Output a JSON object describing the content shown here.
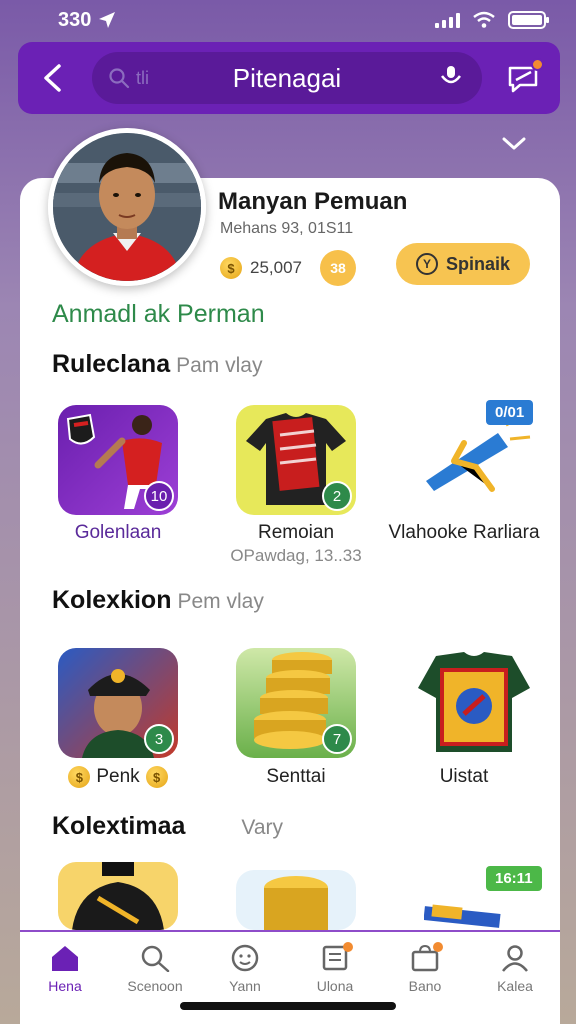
{
  "status_bar": {
    "time": "330"
  },
  "header": {
    "title": "Pitenagai",
    "search_placeholder": "tli",
    "accent_color": "#6b21b5"
  },
  "profile": {
    "name": "Manyan Pemuan",
    "meta": "Mehans 93, 01S11",
    "coins": "25,007",
    "coin_badge": "38",
    "action_label": "Spinaik",
    "subtitle": "Anmadl ak Perman"
  },
  "sections": [
    {
      "title": "Ruleclana",
      "muted": "Pam vlay",
      "items": [
        {
          "label": "Golenlaan",
          "sub": ""
        },
        {
          "label": "Remoian",
          "sub": "OPawdag, 13..33"
        },
        {
          "label": "Vlahooke Rarliara",
          "sub": "",
          "tag": "0/01"
        }
      ]
    },
    {
      "title": "Kolexkion",
      "muted": "Pem vlay",
      "items": [
        {
          "label": "Penk",
          "sub": ""
        },
        {
          "label": "Senttai",
          "sub": ""
        },
        {
          "label": "Uistat",
          "sub": ""
        }
      ]
    },
    {
      "title": "Kolextimaa",
      "muted": "Vary",
      "items": [
        {
          "tag": "16:11"
        }
      ]
    }
  ],
  "tabs": [
    {
      "label": "Hena",
      "icon": "home-icon"
    },
    {
      "label": "Scenoon",
      "icon": "search-icon"
    },
    {
      "label": "Yann",
      "icon": "smile-icon"
    },
    {
      "label": "Ulona",
      "icon": "list-icon"
    },
    {
      "label": "Bano",
      "icon": "bag-icon"
    },
    {
      "label": "Kalea",
      "icon": "profile-icon"
    }
  ]
}
